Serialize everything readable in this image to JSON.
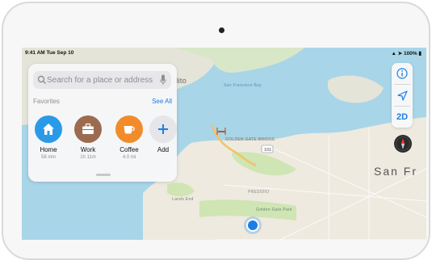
{
  "status_bar": {
    "time_date": "9:41 AM  Tue Sep 10",
    "battery": "100%"
  },
  "search": {
    "placeholder": "Search for a place or address"
  },
  "favorites": {
    "title": "Favorites",
    "see_all": "See All",
    "items": [
      {
        "label": "Home",
        "sublabel": "58 min",
        "icon": "house-icon",
        "color": "#2a9ae8"
      },
      {
        "label": "Work",
        "sublabel": "1h 11m",
        "icon": "briefcase-icon",
        "color": "#9c6b4f"
      },
      {
        "label": "Coffee",
        "sublabel": "4.0 mi",
        "icon": "coffee-cup-icon",
        "color": "#f28b2a"
      },
      {
        "label": "Add",
        "sublabel": "",
        "icon": "plus-icon",
        "color": "#e5e5ea"
      }
    ]
  },
  "map_controls": {
    "mode": "2D",
    "info_icon": "info-icon",
    "location_icon": "location-arrow-icon",
    "compass_icon": "compass-icon"
  },
  "map_labels": {
    "sausalito": "alito",
    "san_francisco": "San Fr",
    "highway": "101",
    "golden_gate_bridge": "GOLDEN GATE BRIDGE",
    "golden_gate_park": "Golden Gate Park",
    "presidio": "PRESIDIO",
    "lands_end": "Lands End",
    "sf_bay": "San Francisco Bay"
  },
  "colors": {
    "water": "#a9d5e8",
    "land": "#eeeae0",
    "park": "#cfe5b4",
    "accent": "#1a7ee6"
  }
}
